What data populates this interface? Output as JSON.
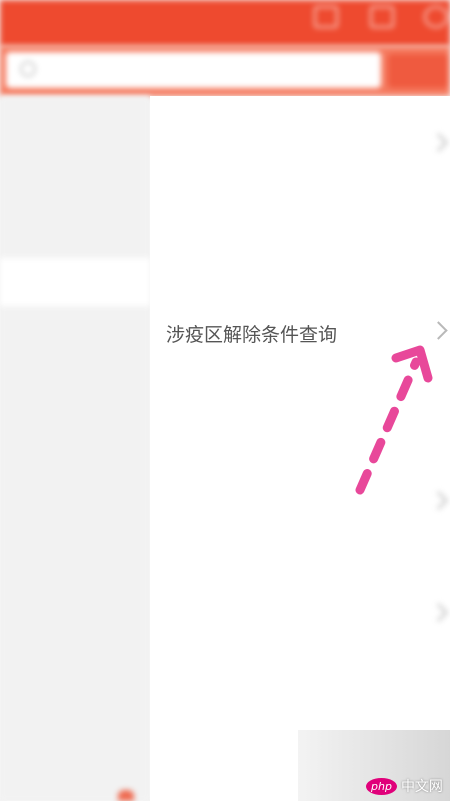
{
  "header": {
    "title": "",
    "icons": [
      "share-icon",
      "more-icon",
      "profile-icon"
    ]
  },
  "search": {
    "placeholder": "",
    "button_label": ""
  },
  "sidebar": {
    "items": [
      {
        "label": "",
        "active": false
      },
      {
        "label": "",
        "active": false
      },
      {
        "label": "",
        "active": false
      },
      {
        "label": "",
        "active": true
      },
      {
        "label": "",
        "active": false
      },
      {
        "label": "",
        "active": false
      },
      {
        "label": "",
        "active": false
      },
      {
        "label": "",
        "active": false
      },
      {
        "label": "",
        "active": false
      },
      {
        "label": "",
        "active": false
      },
      {
        "label": "",
        "active": false
      },
      {
        "label": "",
        "active": false
      },
      {
        "label": "",
        "active": false
      }
    ]
  },
  "main": {
    "rows": [
      {
        "label": "",
        "has_chevron": true
      },
      {
        "label": "",
        "has_chevron": false
      },
      {
        "label": "",
        "has_chevron": false
      },
      {
        "label": "涉疫区解除条件查询",
        "has_chevron": true
      },
      {
        "label": "",
        "has_chevron": false
      },
      {
        "label": "",
        "section": true
      },
      {
        "label": "",
        "has_chevron": true
      },
      {
        "label": "",
        "section": true
      },
      {
        "label": "",
        "has_chevron": true
      },
      {
        "label": "",
        "has_chevron": false
      },
      {
        "label": "",
        "has_chevron": false
      }
    ]
  },
  "watermark": {
    "php": "php",
    "text": "中文网"
  },
  "colors": {
    "accent": "#ee4a2f",
    "annotation": "#e8489a"
  }
}
